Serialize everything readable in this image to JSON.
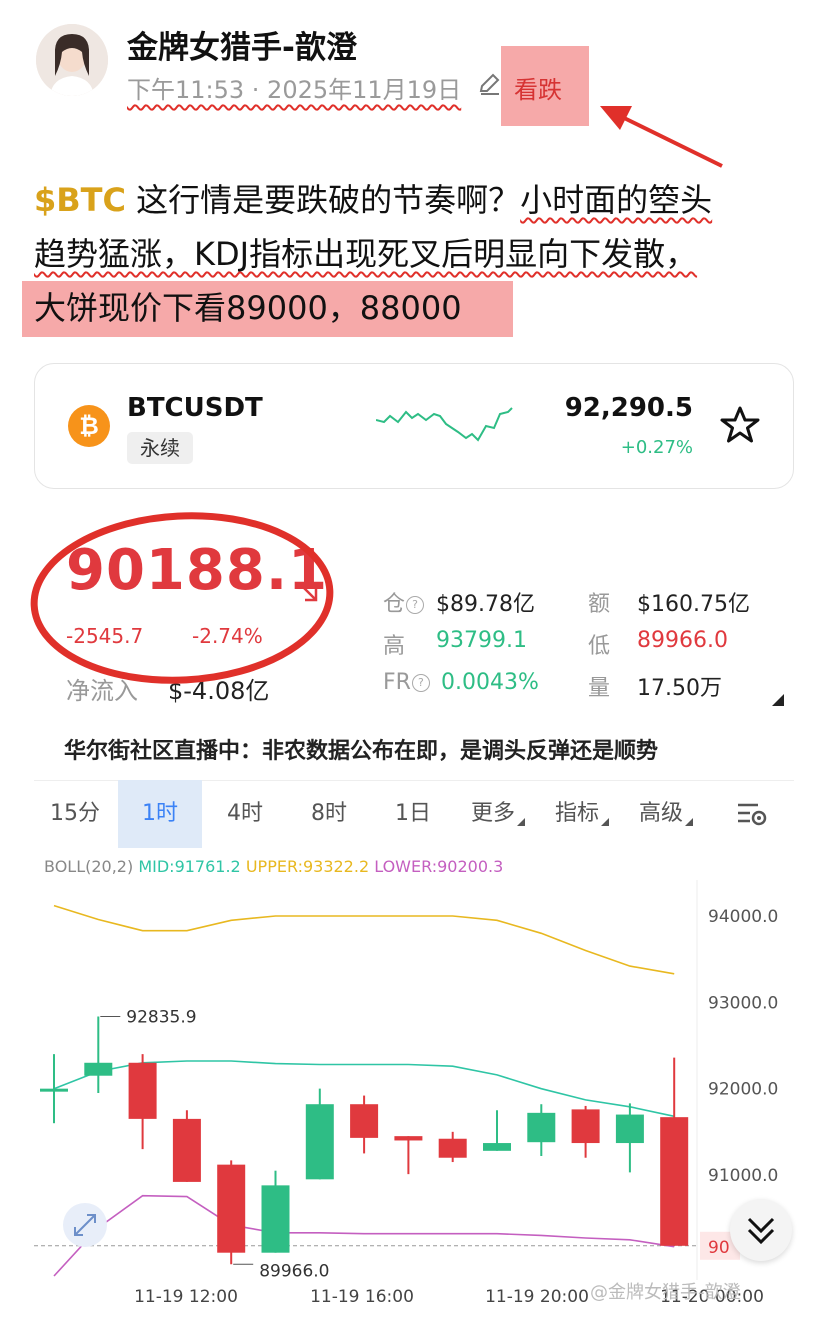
{
  "author": {
    "name": "金牌女猎手-歆澄",
    "post_time": "下午11:53 · 2025年11月19日",
    "sentiment_tag": "看跌"
  },
  "post": {
    "cashtag": "$BTC",
    "line1_rest": " 这行情是要跌破的节奏啊？",
    "line1_underlined": "小时面的箜头",
    "line2": "趋势猛涨，KDJ指标出现死叉后明显向下发散，",
    "line3": "大饼现价下看89000，88000"
  },
  "ticker_card": {
    "symbol": "BTCUSDT",
    "badge": "永续",
    "price": "92,290.5",
    "change": "+0.27%",
    "coin_icon": "bitcoin-icon",
    "fav_icon": "star-icon"
  },
  "market": {
    "price": "90188.1",
    "change_abs": "-2545.7",
    "change_pct": "-2.74%",
    "net_inflow_label": "净流入",
    "net_inflow_value": "$-4.08亿",
    "open_interest_label": "仓",
    "open_interest_value": "$89.78亿",
    "turnover_label": "额",
    "turnover_value": "$160.75亿",
    "high_label": "高",
    "high_value": "93799.1",
    "low_label": "低",
    "low_value": "89966.0",
    "fr_label": "FR",
    "fr_value": "0.0043%",
    "volume_label": "量",
    "volume_value": "17.50万",
    "headline": "华尔街社区直播中：非农数据公布在即，是调头反弹还是顺势"
  },
  "tabs": [
    "15分",
    "1时",
    "4时",
    "8时",
    "1日",
    "更多",
    "指标",
    "高级"
  ],
  "active_tab": "1时",
  "indicator": {
    "name": "BOLL(20,2)",
    "mid": "MID:91761.2",
    "upper": "UPPER:93322.2",
    "lower": "LOWER:90200.3",
    "mid_color": "#2fc5a5",
    "upper_color": "#e8b820",
    "lower_color": "#c45fc0"
  },
  "chart_data": {
    "type": "candlestick",
    "y_ticks": [
      "94000.0",
      "93000.0",
      "92000.0",
      "91000.0"
    ],
    "y_tick_values": [
      94000,
      93000,
      92000,
      91000
    ],
    "current_price_label": "90",
    "x_ticks": [
      "11-19 12:00",
      "11-19 16:00",
      "11-19 20:00",
      "11-20 00:00"
    ],
    "annotations": {
      "high": "92835.9",
      "low": "89966.0"
    },
    "candles": [
      {
        "o": 92000,
        "c": 92000,
        "h": 92400,
        "l": 91600
      },
      {
        "o": 92150,
        "c": 92300,
        "h": 92835.9,
        "l": 91950
      },
      {
        "o": 92300,
        "c": 91650,
        "h": 92400,
        "l": 91300
      },
      {
        "o": 91650,
        "c": 90920,
        "h": 91750,
        "l": 90920
      },
      {
        "o": 91120,
        "c": 90100,
        "h": 91170,
        "l": 89966.0
      },
      {
        "o": 90100,
        "c": 90880,
        "h": 91050,
        "l": 90100
      },
      {
        "o": 90950,
        "c": 91820,
        "h": 92000,
        "l": 90950
      },
      {
        "o": 91820,
        "c": 91430,
        "h": 91920,
        "l": 91250
      },
      {
        "o": 91450,
        "c": 91400,
        "h": 91450,
        "l": 91010
      },
      {
        "o": 91420,
        "c": 91200,
        "h": 91500,
        "l": 91150
      },
      {
        "o": 91280,
        "c": 91370,
        "h": 91750,
        "l": 91280
      },
      {
        "o": 91380,
        "c": 91720,
        "h": 91820,
        "l": 91220
      },
      {
        "o": 91760,
        "c": 91370,
        "h": 91800,
        "l": 91200
      },
      {
        "o": 91370,
        "c": 91700,
        "h": 91830,
        "l": 91030
      },
      {
        "o": 91670,
        "c": 90180,
        "h": 92360,
        "l": 90180
      }
    ],
    "boll_upper": [
      94120,
      93960,
      93830,
      93830,
      93950,
      94000,
      94000,
      94000,
      94000,
      94000,
      93950,
      93800,
      93600,
      93420,
      93330
    ],
    "boll_mid": [
      92000,
      92200,
      92300,
      92320,
      92320,
      92290,
      92280,
      92280,
      92280,
      92260,
      92160,
      92000,
      91870,
      91790,
      91680
    ],
    "boll_lower": [
      89830,
      90390,
      90760,
      90750,
      90420,
      90330,
      90330,
      90320,
      90320,
      90320,
      90320,
      90300,
      90270,
      90250,
      90170
    ]
  },
  "watermark": "@金牌女猎手-歆澄"
}
